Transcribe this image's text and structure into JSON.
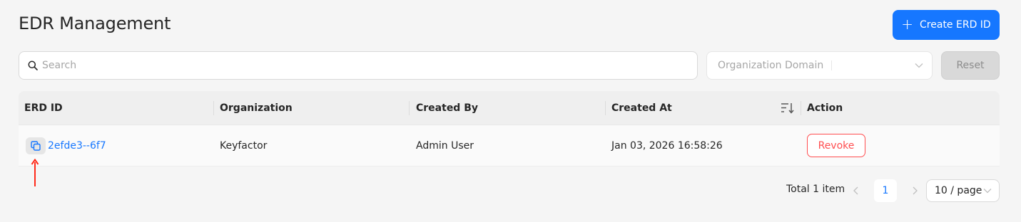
{
  "header": {
    "title": "EDR Management",
    "create_button_label": "Create ERD ID",
    "create_button_icon": "plus-icon"
  },
  "filters": {
    "search_placeholder": "Search",
    "org_domain_placeholder": "Organization Domain",
    "reset_label": "Reset"
  },
  "table": {
    "columns": [
      "ERD ID",
      "Organization",
      "Created By",
      "Created At",
      "Action"
    ],
    "rows": [
      {
        "erd_id": "2efde3--6f7",
        "organization": "Keyfactor",
        "created_by": "Admin User",
        "created_at": "Jan 03, 2026 16:58:26",
        "action_label": "Revoke"
      }
    ]
  },
  "pagination": {
    "total_text": "Total 1 item",
    "current_page": "1",
    "page_size": "10 / page"
  },
  "colors": {
    "primary": "#1677ff",
    "danger": "#ff4d4f",
    "annotation_arrow": "#ff2a1a",
    "background": "#f5f5f5"
  }
}
